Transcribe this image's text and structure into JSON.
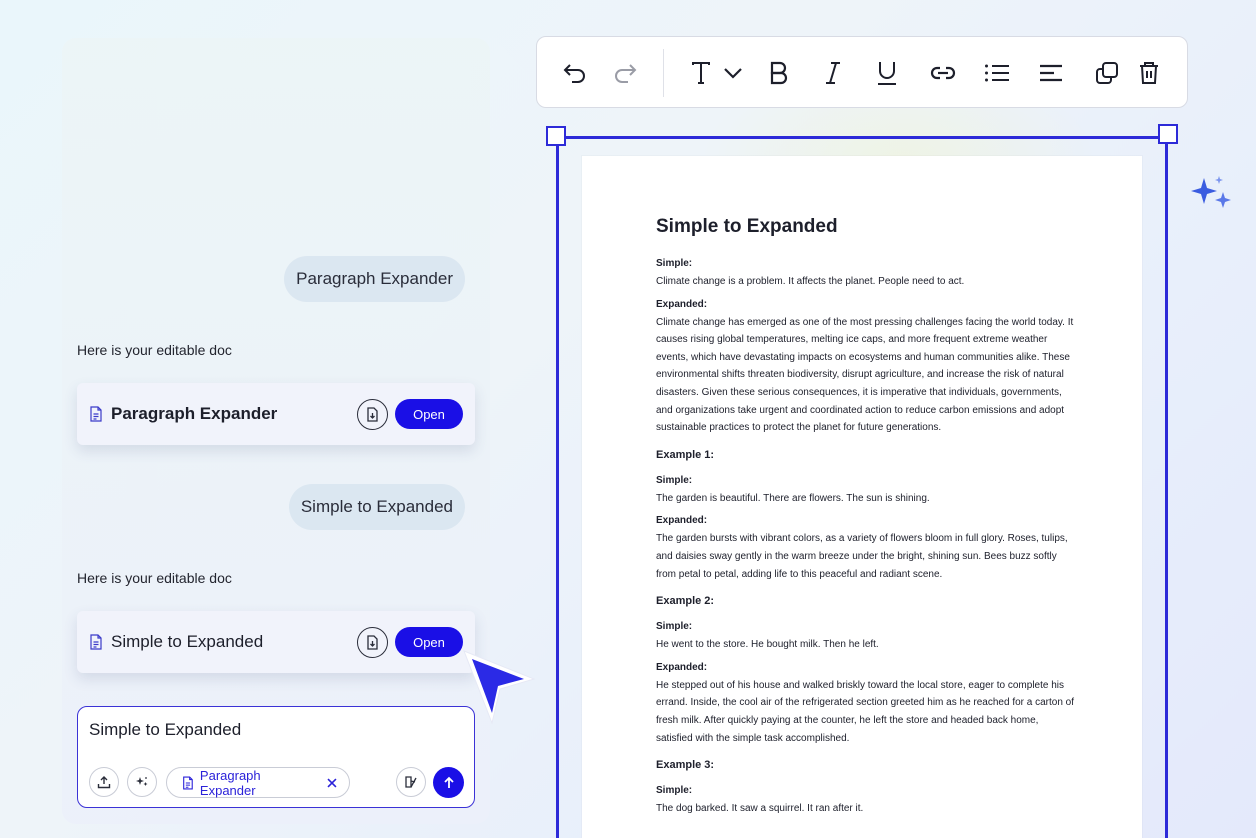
{
  "chat": {
    "messages": [
      {
        "type": "user",
        "text": "Paragraph Expander"
      },
      {
        "type": "bot",
        "text": "Here is your editable doc"
      },
      {
        "type": "doc",
        "title": "Paragraph Expander",
        "open_label": "Open"
      },
      {
        "type": "user",
        "text": "Simple to Expanded"
      },
      {
        "type": "bot",
        "text": "Here is your editable doc"
      },
      {
        "type": "doc",
        "title": "Simple to Expanded",
        "open_label": "Open"
      }
    ],
    "composer": {
      "value": "Simple to Expanded",
      "chip_label": "Paragraph Expander"
    }
  },
  "toolbar": {
    "icons": [
      "undo-icon",
      "redo-icon",
      "text-style-icon",
      "chevron-down-icon",
      "bold-icon",
      "italic-icon",
      "underline-icon",
      "link-icon",
      "bullet-list-icon",
      "align-left-icon",
      "duplicate-icon",
      "delete-icon"
    ]
  },
  "document": {
    "title": "Simple to Expanded",
    "intro_simple_label": "Simple:",
    "intro_simple": "Climate change is a problem. It affects the planet. People need to act.",
    "intro_expanded_label": "Expanded:",
    "intro_expanded": "Climate change has emerged as one of the most pressing challenges facing the world today. It causes rising global temperatures, melting ice caps, and more frequent extreme weather events, which have devastating impacts on ecosystems and human communities alike. These environmental shifts threaten biodiversity, disrupt agriculture, and increase the risk of natural disasters. Given these serious consequences, it is imperative that individuals, governments, and organizations take urgent and coordinated action to reduce carbon emissions and adopt sustainable practices to protect the planet for future generations.",
    "examples": [
      {
        "heading": "Example 1:",
        "simple_label": "Simple:",
        "simple": "The garden is beautiful. There are flowers. The sun is shining.",
        "expanded_label": "Expanded:",
        "expanded": "The garden bursts with vibrant colors, as a variety of flowers bloom in full glory. Roses, tulips, and daisies sway gently in the warm breeze under the bright, shining sun. Bees buzz softly from petal to petal, adding life to this peaceful and radiant scene."
      },
      {
        "heading": "Example 2:",
        "simple_label": "Simple:",
        "simple": "He went to the store. He bought milk. Then he left.",
        "expanded_label": "Expanded:",
        "expanded": "He stepped out of his house and walked briskly toward the local store, eager to complete his errand. Inside, the cool air of the refrigerated section greeted him as he reached for a carton of fresh milk. After quickly paying at the counter, he left the store and headed back home, satisfied with the simple task accomplished."
      },
      {
        "heading": "Example 3:",
        "simple_label": "Simple:",
        "simple": "The dog barked. It saw a squirrel. It ran after it."
      }
    ]
  },
  "colors": {
    "accent": "#1a0fe6",
    "frame": "#2d2ad8",
    "bubble": "#dbe7f1"
  }
}
